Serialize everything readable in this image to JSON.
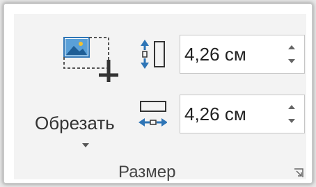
{
  "crop": {
    "label": "Обрезать",
    "icon": "crop-picture-icon"
  },
  "size": {
    "height_value": "4,26 см",
    "width_value": "4,26 см",
    "height_icon": "shape-height-icon",
    "width_icon": "shape-width-icon"
  },
  "group": {
    "label": "Размер",
    "launcher_icon": "dialog-launcher-icon"
  },
  "colors": {
    "accent": "#2e75b6",
    "ribbon": "#f3f3f3"
  }
}
